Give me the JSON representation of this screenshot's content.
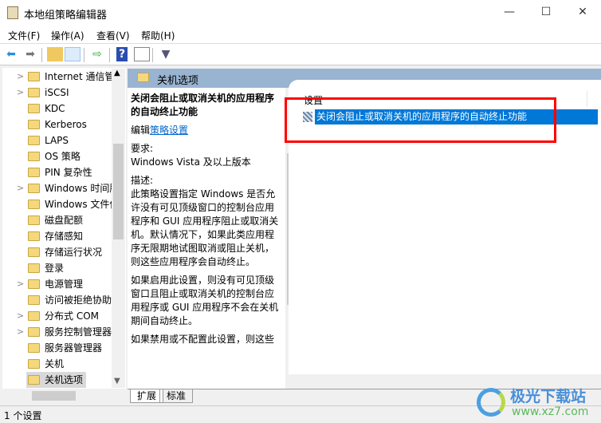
{
  "window": {
    "title": "本地组策略编辑器",
    "minimize": "—",
    "maximize": "☐",
    "close": "✕"
  },
  "menu": [
    "文件(F)",
    "操作(A)",
    "查看(V)",
    "帮助(H)"
  ],
  "toolbar": [
    "back-icon",
    "forward-icon",
    "up-folder-icon",
    "show-hide-tree-icon",
    "export-list-icon",
    "help-icon",
    "show-hide-action-icon",
    "filter-icon"
  ],
  "tree": {
    "items": [
      {
        "label": "Internet 通信管",
        "expandable": true
      },
      {
        "label": "iSCSI",
        "expandable": true
      },
      {
        "label": "KDC",
        "expandable": false
      },
      {
        "label": "Kerberos",
        "expandable": false
      },
      {
        "label": "LAPS",
        "expandable": false
      },
      {
        "label": "OS 策略",
        "expandable": false
      },
      {
        "label": "PIN 复杂性",
        "expandable": false
      },
      {
        "label": "Windows 时间服",
        "expandable": true
      },
      {
        "label": "Windows 文件保",
        "expandable": false
      },
      {
        "label": "磁盘配额",
        "expandable": false
      },
      {
        "label": "存储感知",
        "expandable": false
      },
      {
        "label": "存储运行状况",
        "expandable": false
      },
      {
        "label": "登录",
        "expandable": false
      },
      {
        "label": "电源管理",
        "expandable": true
      },
      {
        "label": "访问被拒绝协助",
        "expandable": false
      },
      {
        "label": "分布式 COM",
        "expandable": true
      },
      {
        "label": "服务控制管理器",
        "expandable": true
      },
      {
        "label": "服务器管理器",
        "expandable": false
      },
      {
        "label": "关机",
        "expandable": false
      },
      {
        "label": "关机选项",
        "expandable": false,
        "selected": true
      }
    ]
  },
  "right_header": "关机选项",
  "description": {
    "title": "关闭会阻止或取消关机的应用程序的自动终止功能",
    "edit_prefix": "编辑",
    "edit_link": "策略设置",
    "req_label": "要求:",
    "req_value": "Windows Vista 及以上版本",
    "desc_label": "描述:",
    "p1": "此策略设置指定 Windows 是否允许没有可见顶级窗口的控制台应用程序和 GUI 应用程序阻止或取消关机。默认情况下，如果此类应用程序无限期地试图取消或阻止关机，则这些应用程序会自动终止。",
    "p2": "如果启用此设置，则没有可见顶级窗口且阻止或取消关机的控制台应用程序或 GUI 应用程序不会在关机期间自动终止。",
    "p3": "如果禁用或不配置此设置，则这些"
  },
  "list": {
    "header": "设置",
    "rows": [
      "关闭会阻止或取消关机的应用程序的自动终止功能"
    ]
  },
  "tabs": [
    "扩展",
    "标准"
  ],
  "status": "1 个设置",
  "watermark": {
    "name": "极光下载站",
    "url": "www.xz7.com"
  },
  "colors": {
    "selection": "#0078d7",
    "header_band": "#99b4d1",
    "highlight_box": "#ff0000"
  }
}
